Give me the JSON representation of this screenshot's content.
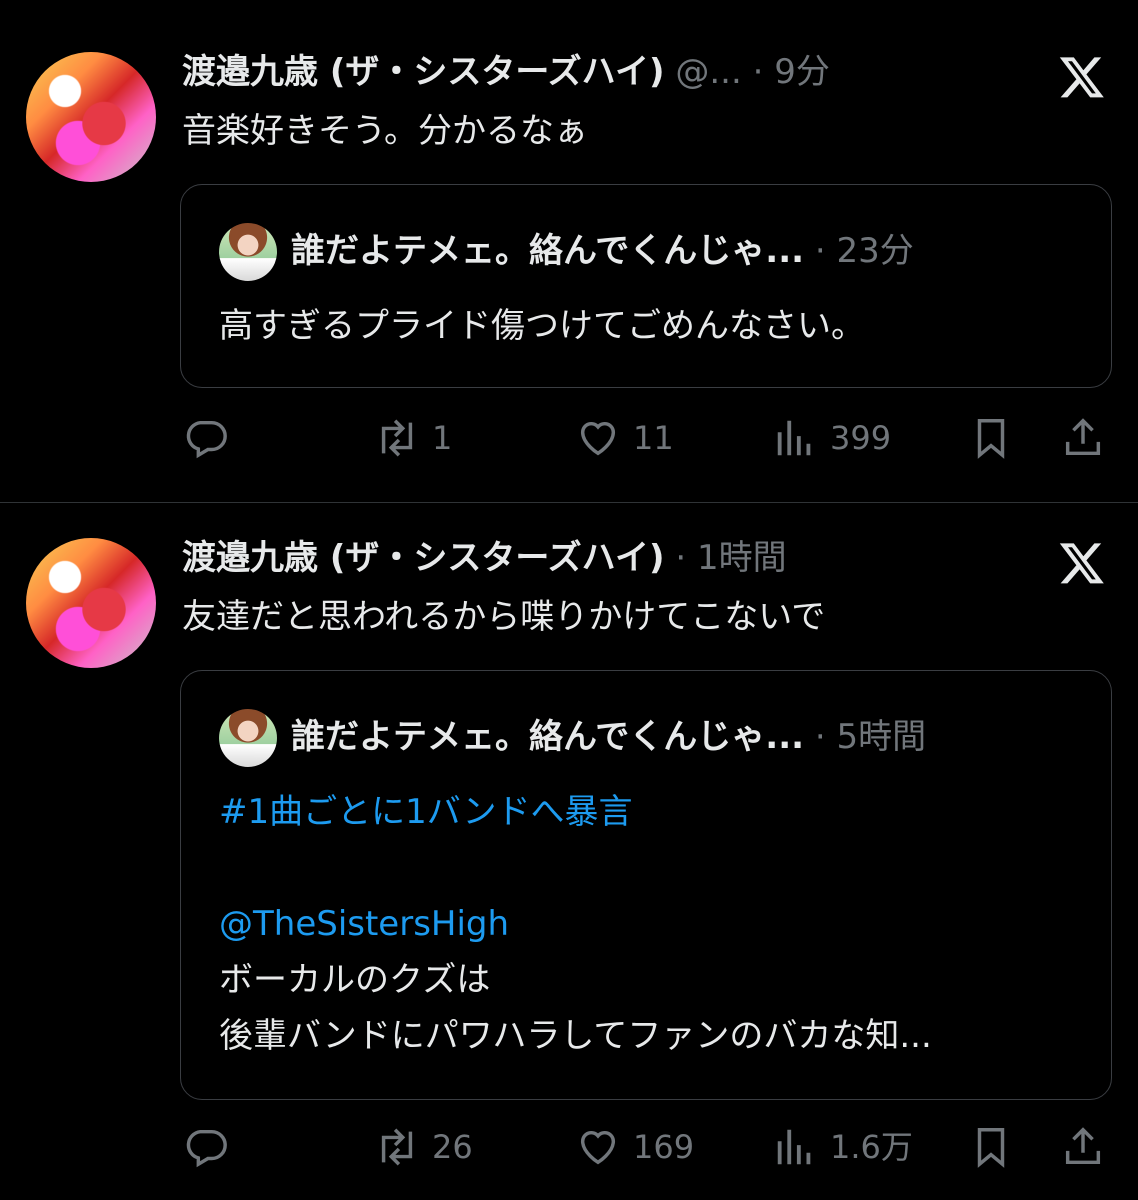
{
  "tweets": [
    {
      "author": "渡邉九歳 (ザ・シスターズハイ)",
      "handle": "@...",
      "separator": "·",
      "time": "9分",
      "text": "音楽好きそう。分かるなぁ",
      "quote": {
        "author": "誰だよテメェ。絡んでくんじゃ...",
        "separator": "·",
        "time": "23分",
        "lines": [
          "高すぎるプライド傷つけてごめんなさい。"
        ]
      },
      "actions": {
        "reply": "",
        "retweet": "1",
        "like": "11",
        "views": "399"
      }
    },
    {
      "author": "渡邉九歳 (ザ・シスターズハイ)",
      "separator": "·",
      "time": "1時間",
      "text": "友達だと思われるから喋りかけてこないで",
      "quote": {
        "author": "誰だよテメェ。絡んでくんじゃ...",
        "separator": "·",
        "time": "5時間",
        "hashtag": "#1曲ごとに1バンドへ暴言",
        "mention": "@TheSistersHigh",
        "lines": [
          "ボーカルのクズは",
          "後輩バンドにパワハラしてファンのバカな知..."
        ]
      },
      "actions": {
        "reply": "",
        "retweet": "26",
        "like": "169",
        "views": "1.6万"
      }
    }
  ],
  "icons": {
    "reply": "reply-icon",
    "retweet": "retweet-icon",
    "like": "heart-icon",
    "views": "views-icon",
    "bookmark": "bookmark-icon",
    "share": "share-icon",
    "logo": "x-logo-icon"
  },
  "colors": {
    "background": "#000000",
    "text": "#e7e9ea",
    "muted": "#71767b",
    "link": "#1d9bf0",
    "border": "#2f3336"
  }
}
